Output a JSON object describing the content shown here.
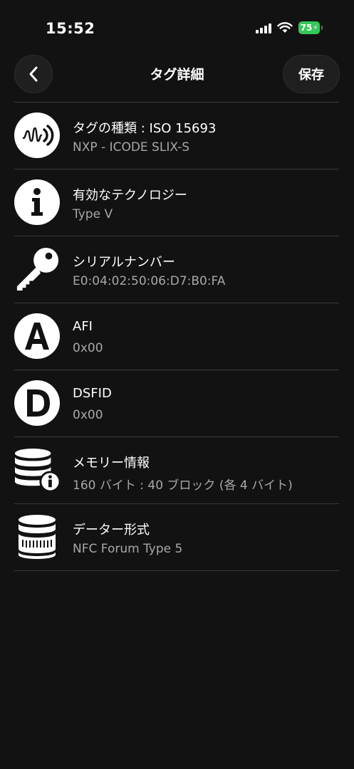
{
  "status_bar": {
    "time": "15:52",
    "battery": "75"
  },
  "nav": {
    "title": "タグ詳細",
    "save_label": "保存"
  },
  "rows": [
    {
      "icon": "nfc-wave-icon",
      "title": "タグの種類 : ISO 15693",
      "value": "NXP - ICODE SLIX-S"
    },
    {
      "icon": "info-icon",
      "title": "有効なテクノロジー",
      "value": "Type V"
    },
    {
      "icon": "key-icon",
      "title": "シリアルナンバー",
      "value": "E0:04:02:50:06:D7:B0:FA"
    },
    {
      "icon": "letter-a-icon",
      "letter": "A",
      "title": "AFI",
      "value": "0x00"
    },
    {
      "icon": "letter-d-icon",
      "letter": "D",
      "title": "DSFID",
      "value": "0x00"
    },
    {
      "icon": "database-info-icon",
      "title": "メモリー情報",
      "value": "160 バイト : 40 ブロック (各 4 バイト)"
    },
    {
      "icon": "database-icon",
      "title": "データー形式",
      "value": "NFC Forum Type 5"
    }
  ],
  "colors": {
    "background": "#121212",
    "divider": "#3a3a3a",
    "secondary_text": "#a8a8a8",
    "battery": "#34c759"
  }
}
